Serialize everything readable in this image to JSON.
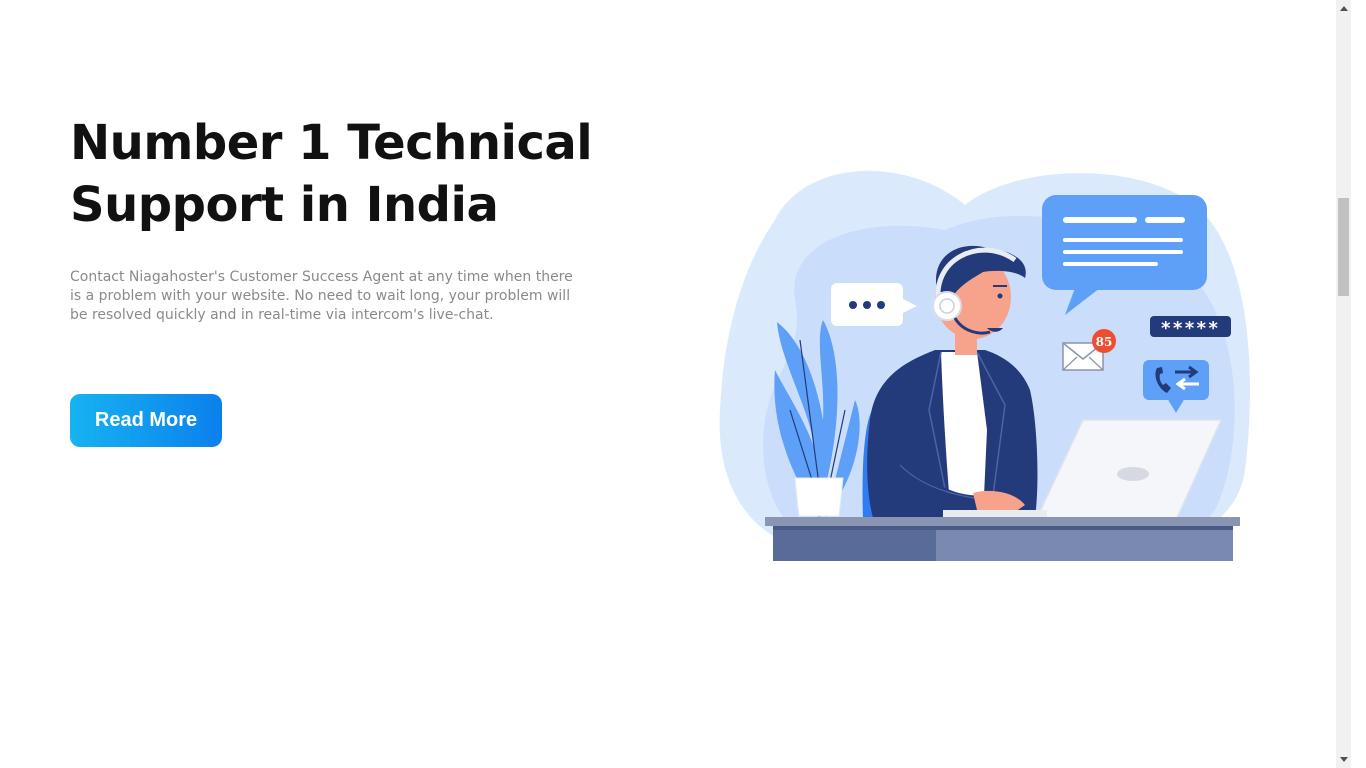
{
  "hero": {
    "title": "Number 1 Technical Support in India",
    "description": "Contact Niagahoster's Customer Success Agent at any time when there is a problem with your website. No need to wait long, your problem will be resolved quickly and in real-time via intercom's live-chat.",
    "cta_label": "Read More"
  },
  "illustration": {
    "notification_count": "85",
    "password_mask": "*****",
    "icons": [
      "headset-agent",
      "chat-bubble-icon",
      "typing-bubble-icon",
      "mail-icon",
      "phone-transfer-icon",
      "plant",
      "laptop"
    ]
  },
  "colors": {
    "cta_start": "#17b3f1",
    "cta_end": "#0b80ec",
    "title": "#111111",
    "description": "#8a8a8a",
    "blob_light": "#dbe9fd",
    "blob_mid": "#bcd6fb",
    "bubble_blue": "#5ea0f7",
    "navy": "#233a7b",
    "badge_red": "#ee4e2f"
  }
}
